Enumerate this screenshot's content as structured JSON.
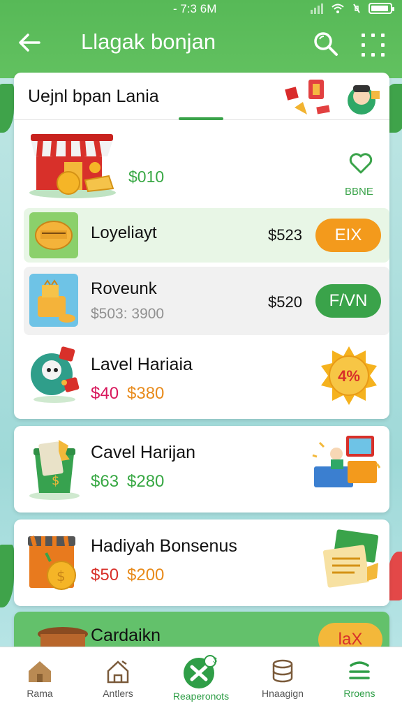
{
  "status_bar": {
    "time": "- 7:3 6M"
  },
  "header": {
    "title": "Llagak bonjan"
  },
  "section": {
    "title": "Uejnl bpan Lania"
  },
  "featured": {
    "amount": "$010",
    "fav_label": "BBNE"
  },
  "rows": [
    {
      "name": "Loyeliayt",
      "price": "$523",
      "action": "EΙX"
    },
    {
      "name": "Roveunk",
      "sub": "$503: 3900",
      "price": "$520",
      "action": "F/VN"
    }
  ],
  "promo": {
    "name": "Lavel Hariaia",
    "amount_1": "$40",
    "amount_2": "$380",
    "badge": "4%"
  },
  "cards": [
    {
      "name": "Cavel Harijan",
      "amount_1": "$63",
      "amount_2": "$280"
    },
    {
      "name": "Hadiyah Bonsenus",
      "amount_1": "$50",
      "amount_2": "$200"
    },
    {
      "name": "Cardaikn",
      "action": "laX"
    }
  ],
  "bottom_nav": [
    {
      "label": "Rama",
      "icon": "home-icon"
    },
    {
      "label": "Antlers",
      "icon": "house-outline-icon"
    },
    {
      "label": "Reaperonots",
      "icon": "reward-icon",
      "badge": "3"
    },
    {
      "label": "Hnaagign",
      "icon": "database-icon"
    },
    {
      "label": "Rroens",
      "icon": "menu-icon"
    }
  ],
  "colors": {
    "brand_green": "#58b958",
    "accent_orange": "#f39a1c",
    "button_green": "#3aa34a"
  }
}
